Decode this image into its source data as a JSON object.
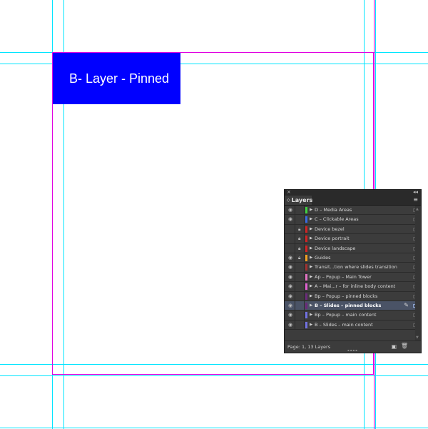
{
  "canvas": {
    "block_label": "B- Layer - Pinned",
    "guide_color": "#00e5ff",
    "margin_color": "#e000e0",
    "block_color": "#0000ff"
  },
  "layers_panel": {
    "close_glyph": "×",
    "collapse_glyph": "◂◂",
    "tab_label": "Layers",
    "menu_glyph": "≡",
    "layers": [
      {
        "name": "D – Media Areas",
        "color": "#3fd13f",
        "eye": true,
        "lock": false,
        "selected": false
      },
      {
        "name": "C – Clickable Areas",
        "color": "#3a6ae0",
        "eye": true,
        "lock": false,
        "selected": false
      },
      {
        "name": "Device bezel",
        "color": "#d02424",
        "eye": false,
        "lock": true,
        "selected": false
      },
      {
        "name": "Device portrait",
        "color": "#d02424",
        "eye": false,
        "lock": true,
        "selected": false
      },
      {
        "name": "Device landscape",
        "color": "#d02424",
        "eye": false,
        "lock": true,
        "selected": false
      },
      {
        "name": "Guides",
        "color": "#f0a020",
        "eye": true,
        "lock": true,
        "selected": false
      },
      {
        "name": "Transit...tion where slides transition",
        "color": "#a03030",
        "eye": true,
        "lock": false,
        "selected": false
      },
      {
        "name": "Ap – Popup – Main Tower",
        "color": "#e070c0",
        "eye": true,
        "lock": false,
        "selected": false
      },
      {
        "name": "A – Mai...r – for inline body content",
        "color": "#e060d0",
        "eye": true,
        "lock": false,
        "selected": false
      },
      {
        "name": "Bp – Popup – pinned blocks",
        "color": "#6a2a7a",
        "eye": true,
        "lock": false,
        "selected": false
      },
      {
        "name": "B – Slides – pinned blocks",
        "color": "#6a2a7a",
        "eye": true,
        "lock": false,
        "selected": true
      },
      {
        "name": "Bp – Popup – main content",
        "color": "#7070e0",
        "eye": true,
        "lock": false,
        "selected": false
      },
      {
        "name": "B – Slides – main content",
        "color": "#7070e0",
        "eye": true,
        "lock": false,
        "selected": false
      }
    ],
    "status_text": "Page: 1, 13 Layers",
    "new_layer_glyph": "▣",
    "trash_glyph": "🗑"
  }
}
